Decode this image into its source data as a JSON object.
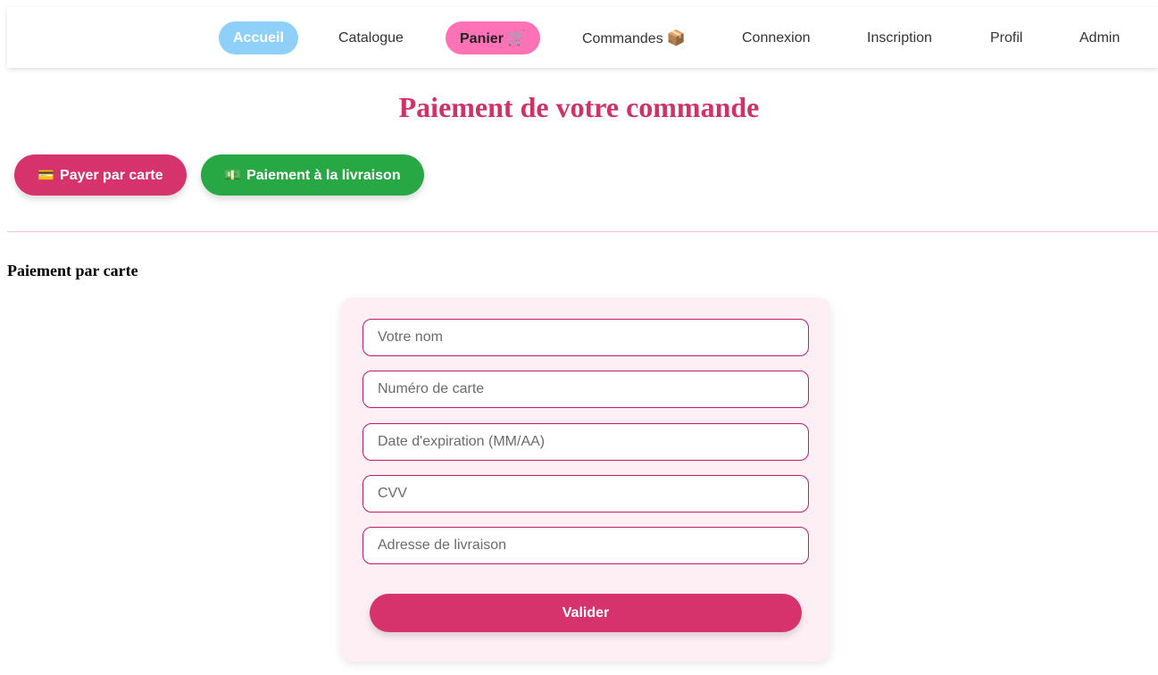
{
  "nav": {
    "items": [
      {
        "label": "Accueil",
        "icon": ""
      },
      {
        "label": "Catalogue",
        "icon": ""
      },
      {
        "label": "Panier",
        "icon": "🛒"
      },
      {
        "label": "Commandes",
        "icon": "📦"
      },
      {
        "label": "Connexion",
        "icon": ""
      },
      {
        "label": "Inscription",
        "icon": ""
      },
      {
        "label": "Profil",
        "icon": ""
      },
      {
        "label": "Admin",
        "icon": ""
      }
    ]
  },
  "page": {
    "title": "Paiement de votre commande"
  },
  "methods": {
    "card": {
      "icon": "💳",
      "label": "Payer par carte"
    },
    "cod": {
      "icon": "💵",
      "label": "Paiement à la livraison"
    }
  },
  "section": {
    "heading": "Paiement par carte"
  },
  "form": {
    "name_placeholder": "Votre nom",
    "card_placeholder": "Numéro de carte",
    "expiry_placeholder": "Date d'expiration (MM/AA)",
    "cvv_placeholder": "CVV",
    "address_placeholder": "Adresse de livraison",
    "name_value": "",
    "card_value": "",
    "expiry_value": "",
    "cvv_value": "",
    "address_value": "",
    "submit_label": "Valider"
  },
  "colors": {
    "accent_pink": "#d6336c",
    "title_pink": "#cf3366",
    "nav_active_blue": "#8fd0fb",
    "nav_cart_pink": "#ff72b6",
    "cod_green": "#28a745",
    "form_bg": "#fdeff4",
    "field_border": "#c2186f"
  }
}
